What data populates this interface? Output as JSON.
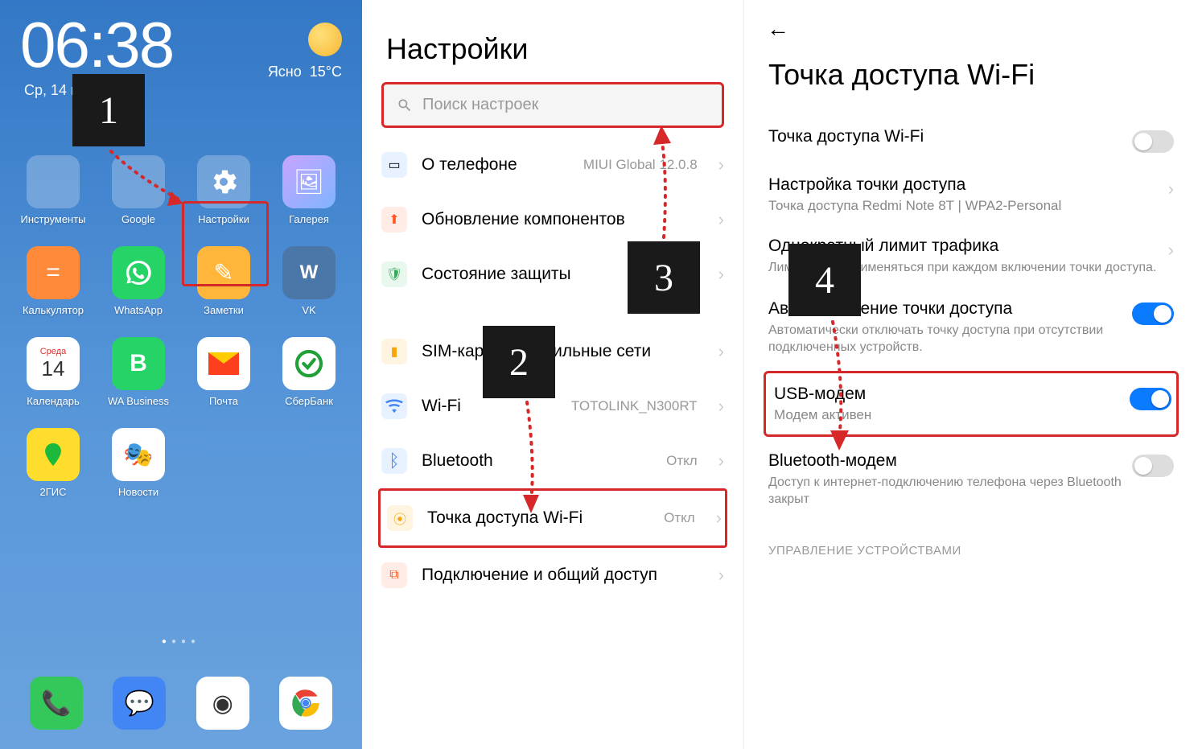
{
  "steps": {
    "s1": "1",
    "s2": "2",
    "s3": "3",
    "s4": "4"
  },
  "home": {
    "time": "06:38",
    "date": "Ср, 14 июля",
    "weather_label": "Ясно",
    "weather_temp": "15°C",
    "apps": {
      "instruments": "Инструменты",
      "google": "Google",
      "settings": "Настройки",
      "gallery": "Галерея",
      "calc": "Калькулятор",
      "whatsapp": "WhatsApp",
      "notes": "Заметки",
      "vk": "VK",
      "calendar": "Календарь",
      "wab": "WA Business",
      "mail": "Почта",
      "sber": "СберБанк",
      "gis": "2ГИС",
      "news": "Новости",
      "calendar_day": "14",
      "calendar_dow": "Среда"
    }
  },
  "settings": {
    "title": "Настройки",
    "search_ph": "Поиск настроек",
    "about": "О телефоне",
    "about_sub": "MIUI Global 12.0.8",
    "update": "Обновление компонентов",
    "security": "Состояние защиты",
    "sim": "SIM-карты и мобильные сети",
    "wifi": "Wi-Fi",
    "wifi_sub": "TOTOLINK_N300RT",
    "bluetooth": "Bluetooth",
    "bt_sub": "Откл",
    "hotspot": "Точка доступа Wi-Fi",
    "hotspot_sub": "Откл",
    "connection": "Подключение и общий доступ"
  },
  "hotspot": {
    "title": "Точка доступа Wi-Fi",
    "toggle1": "Точка доступа Wi-Fi",
    "setup": "Настройка точки доступа",
    "setup_sub": "Точка доступа Redmi Note 8T | WPA2-Personal",
    "limit": "Однократный лимит трафика",
    "limit_sub": "Лимит будет применяться при каждом включении точки доступа.",
    "auto": "Автоотключение точки доступа",
    "auto_sub": "Автоматически отключать точку доступа при отсутствии подключенных устройств.",
    "usb": "USB-модем",
    "usb_sub": "Модем активен",
    "btm": "Bluetooth-модем",
    "btm_sub": "Доступ к интернет-подключению телефона через Bluetooth закрыт",
    "devices": "УПРАВЛЕНИЕ УСТРОЙСТВАМИ"
  }
}
